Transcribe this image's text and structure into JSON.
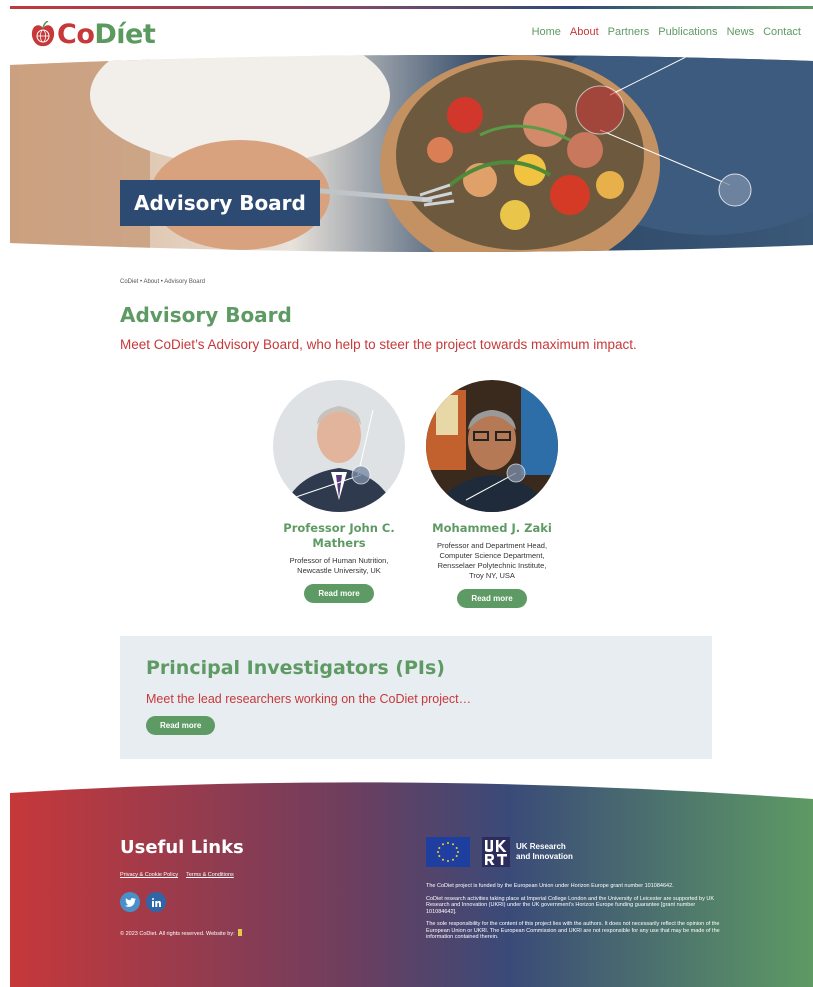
{
  "brand": {
    "co": "Co",
    "diet": "Díet",
    "red": "#c6383a",
    "green": "#5e9a63",
    "navy": "#2d4a73"
  },
  "nav": {
    "items": [
      "Home",
      "About",
      "Partners",
      "Publications",
      "News",
      "Contact"
    ],
    "active_index": 1
  },
  "hero": {
    "label": "Advisory Board"
  },
  "breadcrumb": {
    "text": "CoDiet  •  About  •  Advisory Board"
  },
  "main": {
    "title": "Advisory Board",
    "intro": "Meet CoDiet’s Advisory Board, who help to steer the project towards maximum impact."
  },
  "members": [
    {
      "name": "Professor John C. Mathers",
      "role": "Professor of Human Nutrition,\nNewcastle University, UK",
      "button": "Read more"
    },
    {
      "name": "Mohammed J. Zaki",
      "role": "Professor and Department Head,\nComputer Science Department,\nRensselaer Polytechnic Institute,\nTroy NY, USA",
      "button": "Read more"
    }
  ],
  "pi": {
    "title": "Principal Investigators (PIs)",
    "text": "Meet the lead researchers working on the CoDiet project…",
    "button": "Read more"
  },
  "footer": {
    "title": "Useful Links",
    "links": [
      "Privacy & Cookie Policy",
      "Terms & Conditions"
    ],
    "social_icons": [
      "twitter-icon",
      "linkedin-icon"
    ],
    "copyright": "© 2023 CoDiet. All rights reserved. Website by:",
    "ukri_label": "UK Research\nand Innovation",
    "funding_1": "The CoDiet project is funded by the European Union under Horizon Europe grant number 101084642.",
    "funding_2": "CoDiet research activities taking place at Imperial College London and the University of Leicester are supported by UK Research and Innovation (UKRI) under the UK government’s Horizon Europe funding guarantee [grant number 101084642].",
    "funding_3": "The sole responsibility for the content of this project lies with the authors. It does not necessarily reflect the opinion of the European Union or UKRI. The European Commission and UKRI are not responsible for any use that may be made of the information contained therein."
  }
}
